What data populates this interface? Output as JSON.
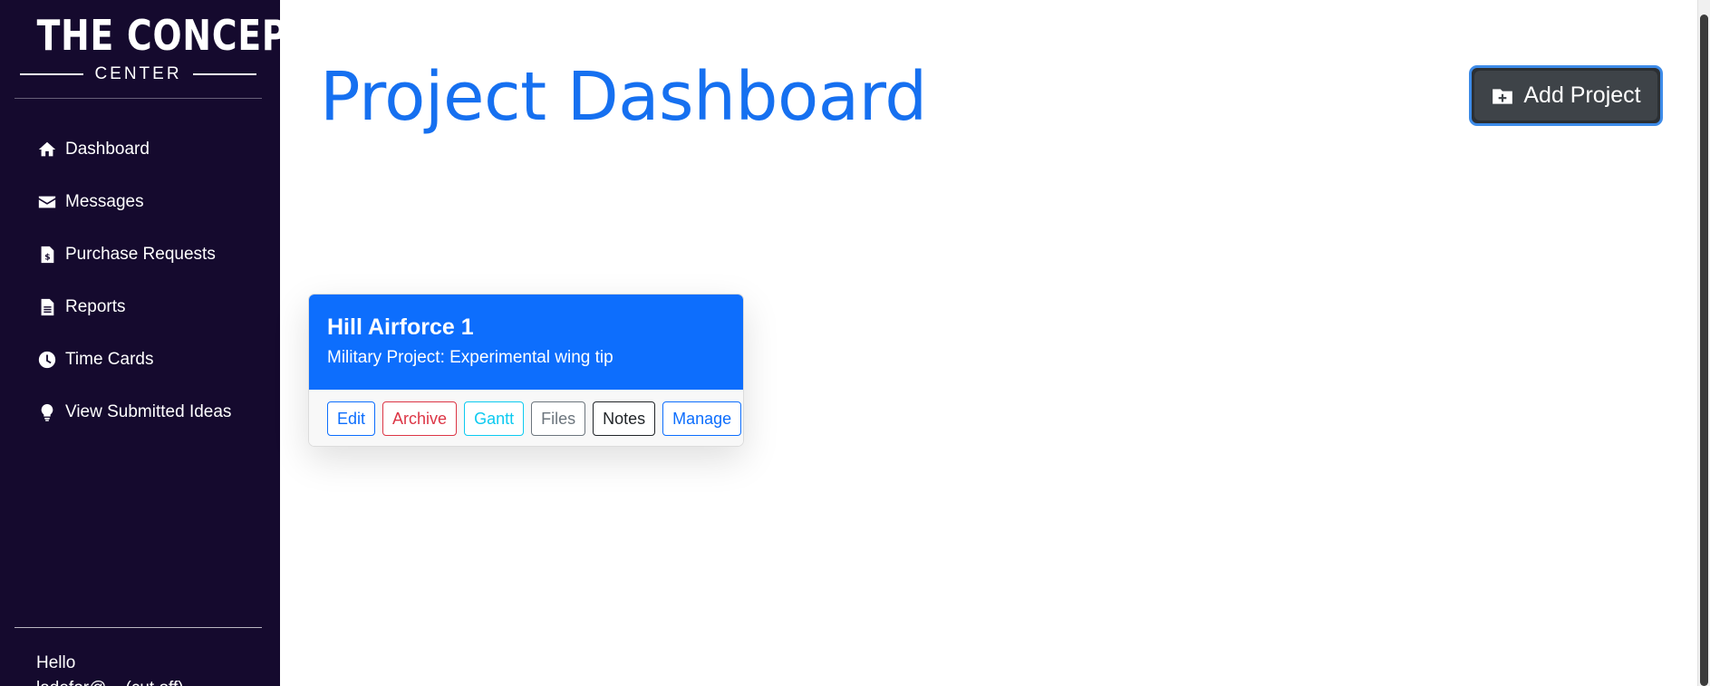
{
  "sidebar": {
    "logo_main": "THE CONCEPT",
    "logo_sub": "CENTER",
    "items": [
      {
        "label": "Dashboard",
        "icon": "home-icon"
      },
      {
        "label": "Messages",
        "icon": "envelope-icon"
      },
      {
        "label": "Purchase Requests",
        "icon": "invoice-dollar-icon"
      },
      {
        "label": "Reports",
        "icon": "document-icon"
      },
      {
        "label": "Time Cards",
        "icon": "clock-icon"
      },
      {
        "label": "View Submitted Ideas",
        "icon": "lightbulb-icon"
      }
    ],
    "greeting": "Hello",
    "user_email": "ladefor@... (cut off)"
  },
  "header": {
    "title": "Project Dashboard",
    "add_button_label": "Add Project",
    "add_button_icon": "folder-plus-icon"
  },
  "projects": [
    {
      "name": "Hill Airforce 1",
      "description": "Military Project: Experimental wing tip",
      "actions": {
        "edit": "Edit",
        "archive": "Archive",
        "gantt": "Gantt",
        "files": "Files",
        "notes": "Notes",
        "manage": "Manage"
      }
    }
  ],
  "colors": {
    "sidebar_bg": "#150a2e",
    "accent": "#1670f0",
    "card_header": "#0d6efd",
    "add_button": "#3e4348"
  }
}
